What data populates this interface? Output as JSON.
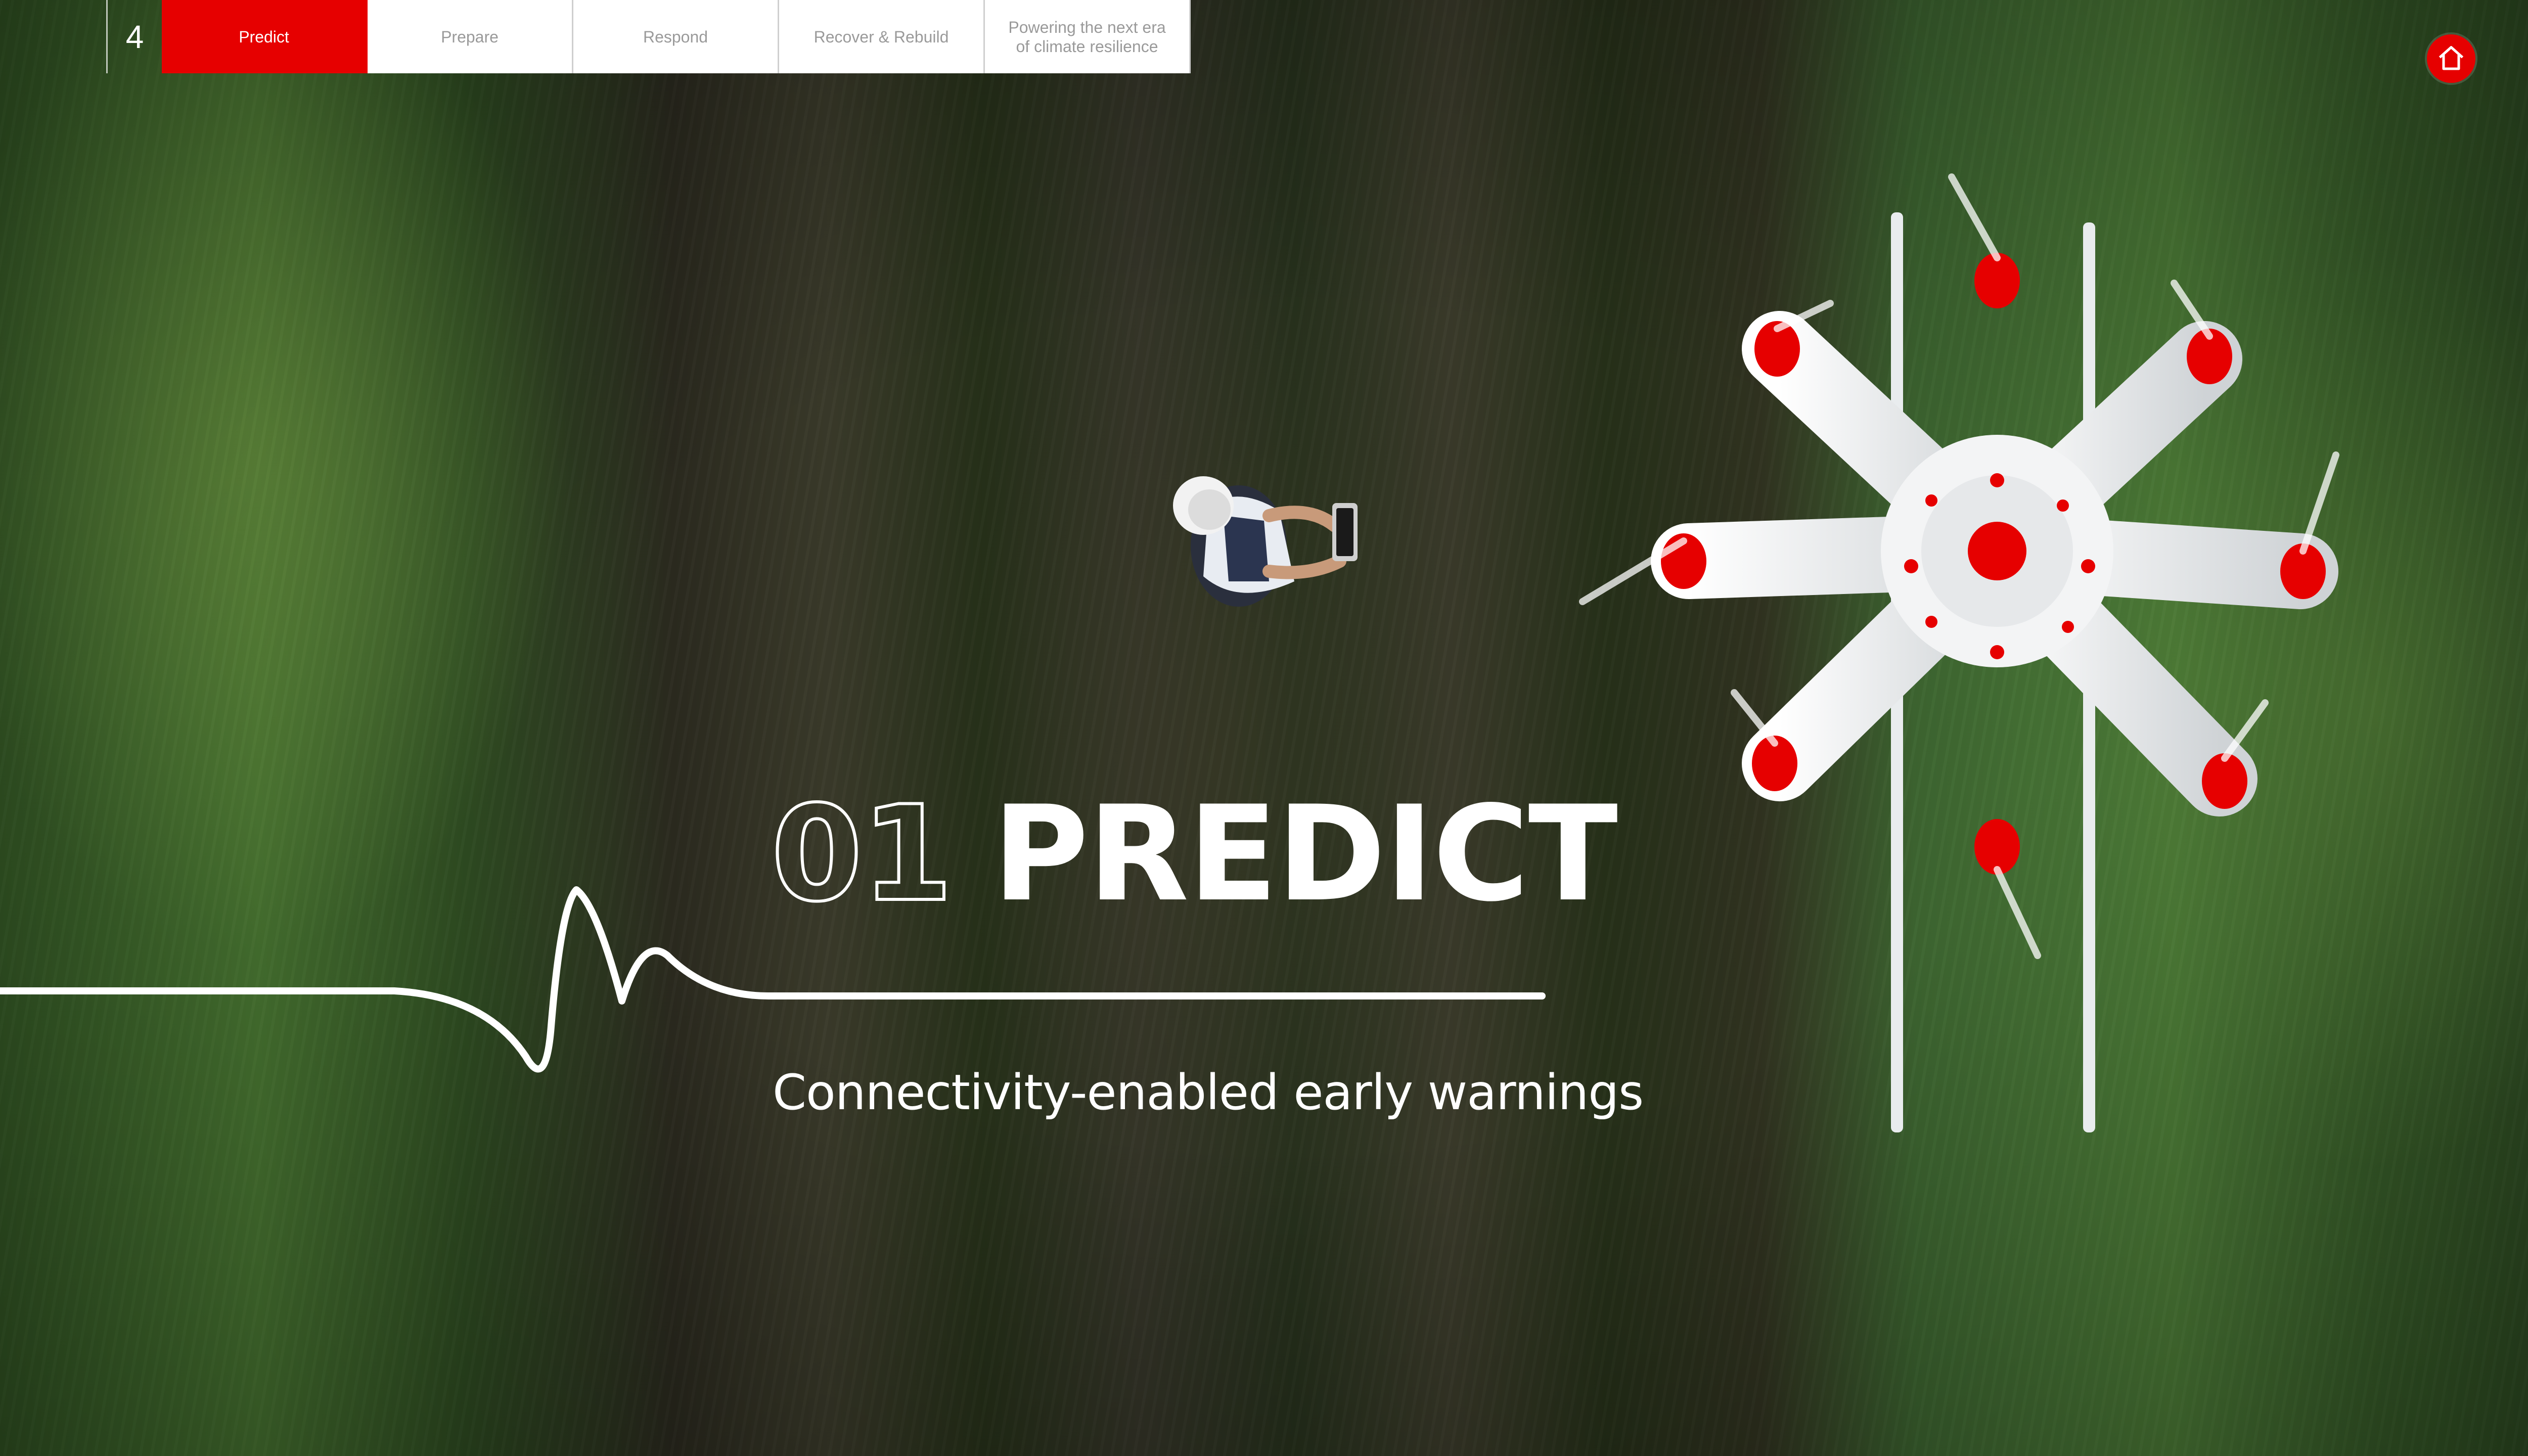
{
  "page": {
    "number": "4"
  },
  "nav": {
    "tabs": [
      {
        "label": "Predict",
        "active": true
      },
      {
        "label": "Prepare",
        "active": false
      },
      {
        "label": "Respond",
        "active": false
      },
      {
        "label": "Recover & Rebuild",
        "active": false
      },
      {
        "label": "Powering the next era\nof climate resilience",
        "active": false
      }
    ],
    "home_icon": "home-icon"
  },
  "hero": {
    "number": "01",
    "title": "PREDICT",
    "subtitle": "Connectivity-enabled early warnings"
  },
  "colors": {
    "accent": "#e60000",
    "text": "#ffffff",
    "tab_bg": "#ffffff",
    "tab_text": "#9a9a9a"
  }
}
